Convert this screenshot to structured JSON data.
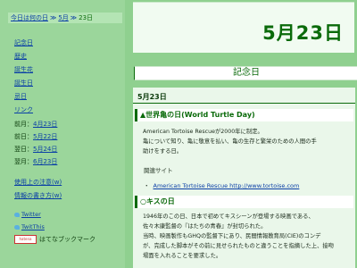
{
  "breadcrumb": {
    "home": "今日は何の日",
    "sep1": "≫",
    "month": "5月",
    "sep2": "≫",
    "current": "23日"
  },
  "nav": [
    "記念日",
    "歴史",
    "誕生花",
    "誕生日",
    "忌日",
    "リンク"
  ],
  "dates": [
    {
      "label": "前月：",
      "link": "4月23日"
    },
    {
      "label": "前日：",
      "link": "5月22日"
    },
    {
      "label": "翌日：",
      "link": "5月24日"
    },
    {
      "label": "翌月：",
      "link": "6月23日"
    }
  ],
  "usage": [
    "使用上の注意(w)",
    "情報の書き方(w)"
  ],
  "share": {
    "twitter": "Twitter",
    "twitthis": "TwitThis",
    "hatena_badge": "hatena",
    "hatena_text": "はてなブックマーク"
  },
  "main": {
    "date_title": "5月23日",
    "section_title": "記念日",
    "date_sub": "5月23日",
    "entries": [
      {
        "title": "▲世界亀の日(World Turtle Day)",
        "lines": [
          "American Tortoise Rescueが2000年に制定。",
          "亀について知り、亀に敬意を払い、亀の生存と繁栄のための人間の手",
          "助けをする日。"
        ],
        "related_label": "関連サイト",
        "related_link": "American Tortoise Rescue http://www.tortoise.com"
      },
      {
        "title": "○キスの日",
        "lines": [
          "1946年のこの日、日本で初めてキスシーンが登場する映画である、",
          "佐々木康監督の『はたちの青春』が封切られた。",
          "当時、映画製作もGHQの監督下にあり、民間情報教育局(CIE)のコンデ",
          "が、完成した脚本がその前に見せられたものと違うことを指摘した上、接吻",
          "場面を入れることを要求した。"
        ]
      }
    ]
  },
  "colors": {
    "background": "#8fd08f",
    "accent": "#0a6a0a",
    "link": "#0a3fa6"
  }
}
